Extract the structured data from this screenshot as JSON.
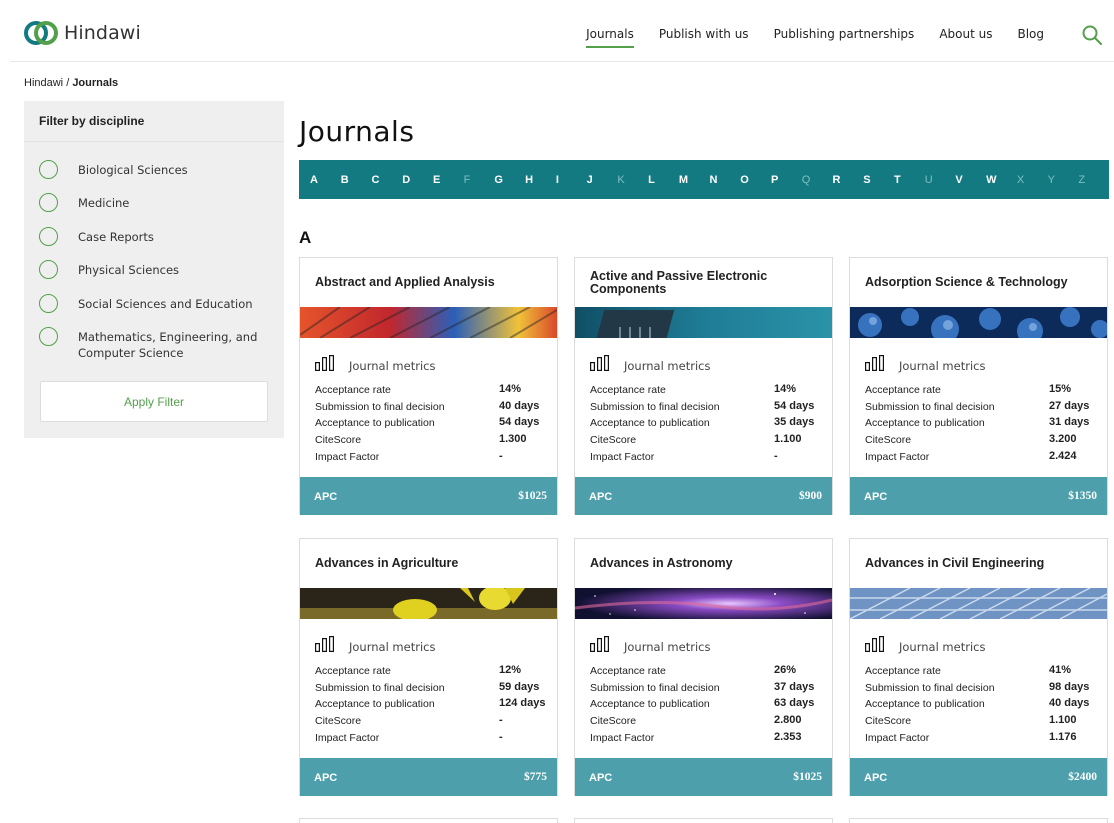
{
  "header": {
    "logo_text": "Hindawi",
    "nav": [
      "Journals",
      "Publish with us",
      "Publishing partnerships",
      "About us",
      "Blog"
    ],
    "active_nav": "Journals",
    "search_icon": "search-icon",
    "accent_color": "#53a04a"
  },
  "breadcrumb": {
    "root": "Hindawi",
    "separator": " / ",
    "current": "Journals"
  },
  "sidebar": {
    "title": "Filter by discipline",
    "items": [
      "Biological Sciences",
      "Medicine",
      "Case Reports",
      "Physical Sciences",
      "Social Sciences and Education",
      "Mathematics, Engineering, and Computer Science"
    ],
    "apply_label": "Apply Filter"
  },
  "main": {
    "title": "Journals",
    "alphabet": [
      "A",
      "B",
      "C",
      "D",
      "E",
      "F",
      "G",
      "H",
      "I",
      "J",
      "K",
      "L",
      "M",
      "N",
      "O",
      "P",
      "Q",
      "R",
      "S",
      "T",
      "U",
      "V",
      "W",
      "X",
      "Y",
      "Z"
    ],
    "disabled_letters": [
      "F",
      "K",
      "Q",
      "U",
      "X",
      "Y",
      "Z"
    ],
    "section_letter": "A",
    "metrics_label": "Journal metrics",
    "metric_keys": [
      "Acceptance rate",
      "Submission to final decision",
      "Acceptance to publication",
      "CiteScore",
      "Impact Factor"
    ],
    "apc_label": "APC",
    "cards": [
      {
        "title": "Abstract and Applied Analysis",
        "metrics": [
          "14%",
          "40 days",
          "54 days",
          "1.300",
          "-"
        ],
        "apc": "$1025"
      },
      {
        "title": "Active and Passive Electronic Components",
        "metrics": [
          "14%",
          "54 days",
          "35 days",
          "1.100",
          "-"
        ],
        "apc": "$900"
      },
      {
        "title": "Adsorption Science & Technology",
        "metrics": [
          "15%",
          "27 days",
          "31 days",
          "3.200",
          "2.424"
        ],
        "apc": "$1350"
      },
      {
        "title": "Advances in Agriculture",
        "metrics": [
          "12%",
          "59 days",
          "124 days",
          "-",
          "-"
        ],
        "apc": "$775"
      },
      {
        "title": "Advances in Astronomy",
        "metrics": [
          "26%",
          "37 days",
          "63 days",
          "2.800",
          "2.353"
        ],
        "apc": "$1025"
      },
      {
        "title": "Advances in Civil Engineering",
        "metrics": [
          "41%",
          "98 days",
          "40 days",
          "1.100",
          "1.176"
        ],
        "apc": "$2400"
      }
    ]
  }
}
